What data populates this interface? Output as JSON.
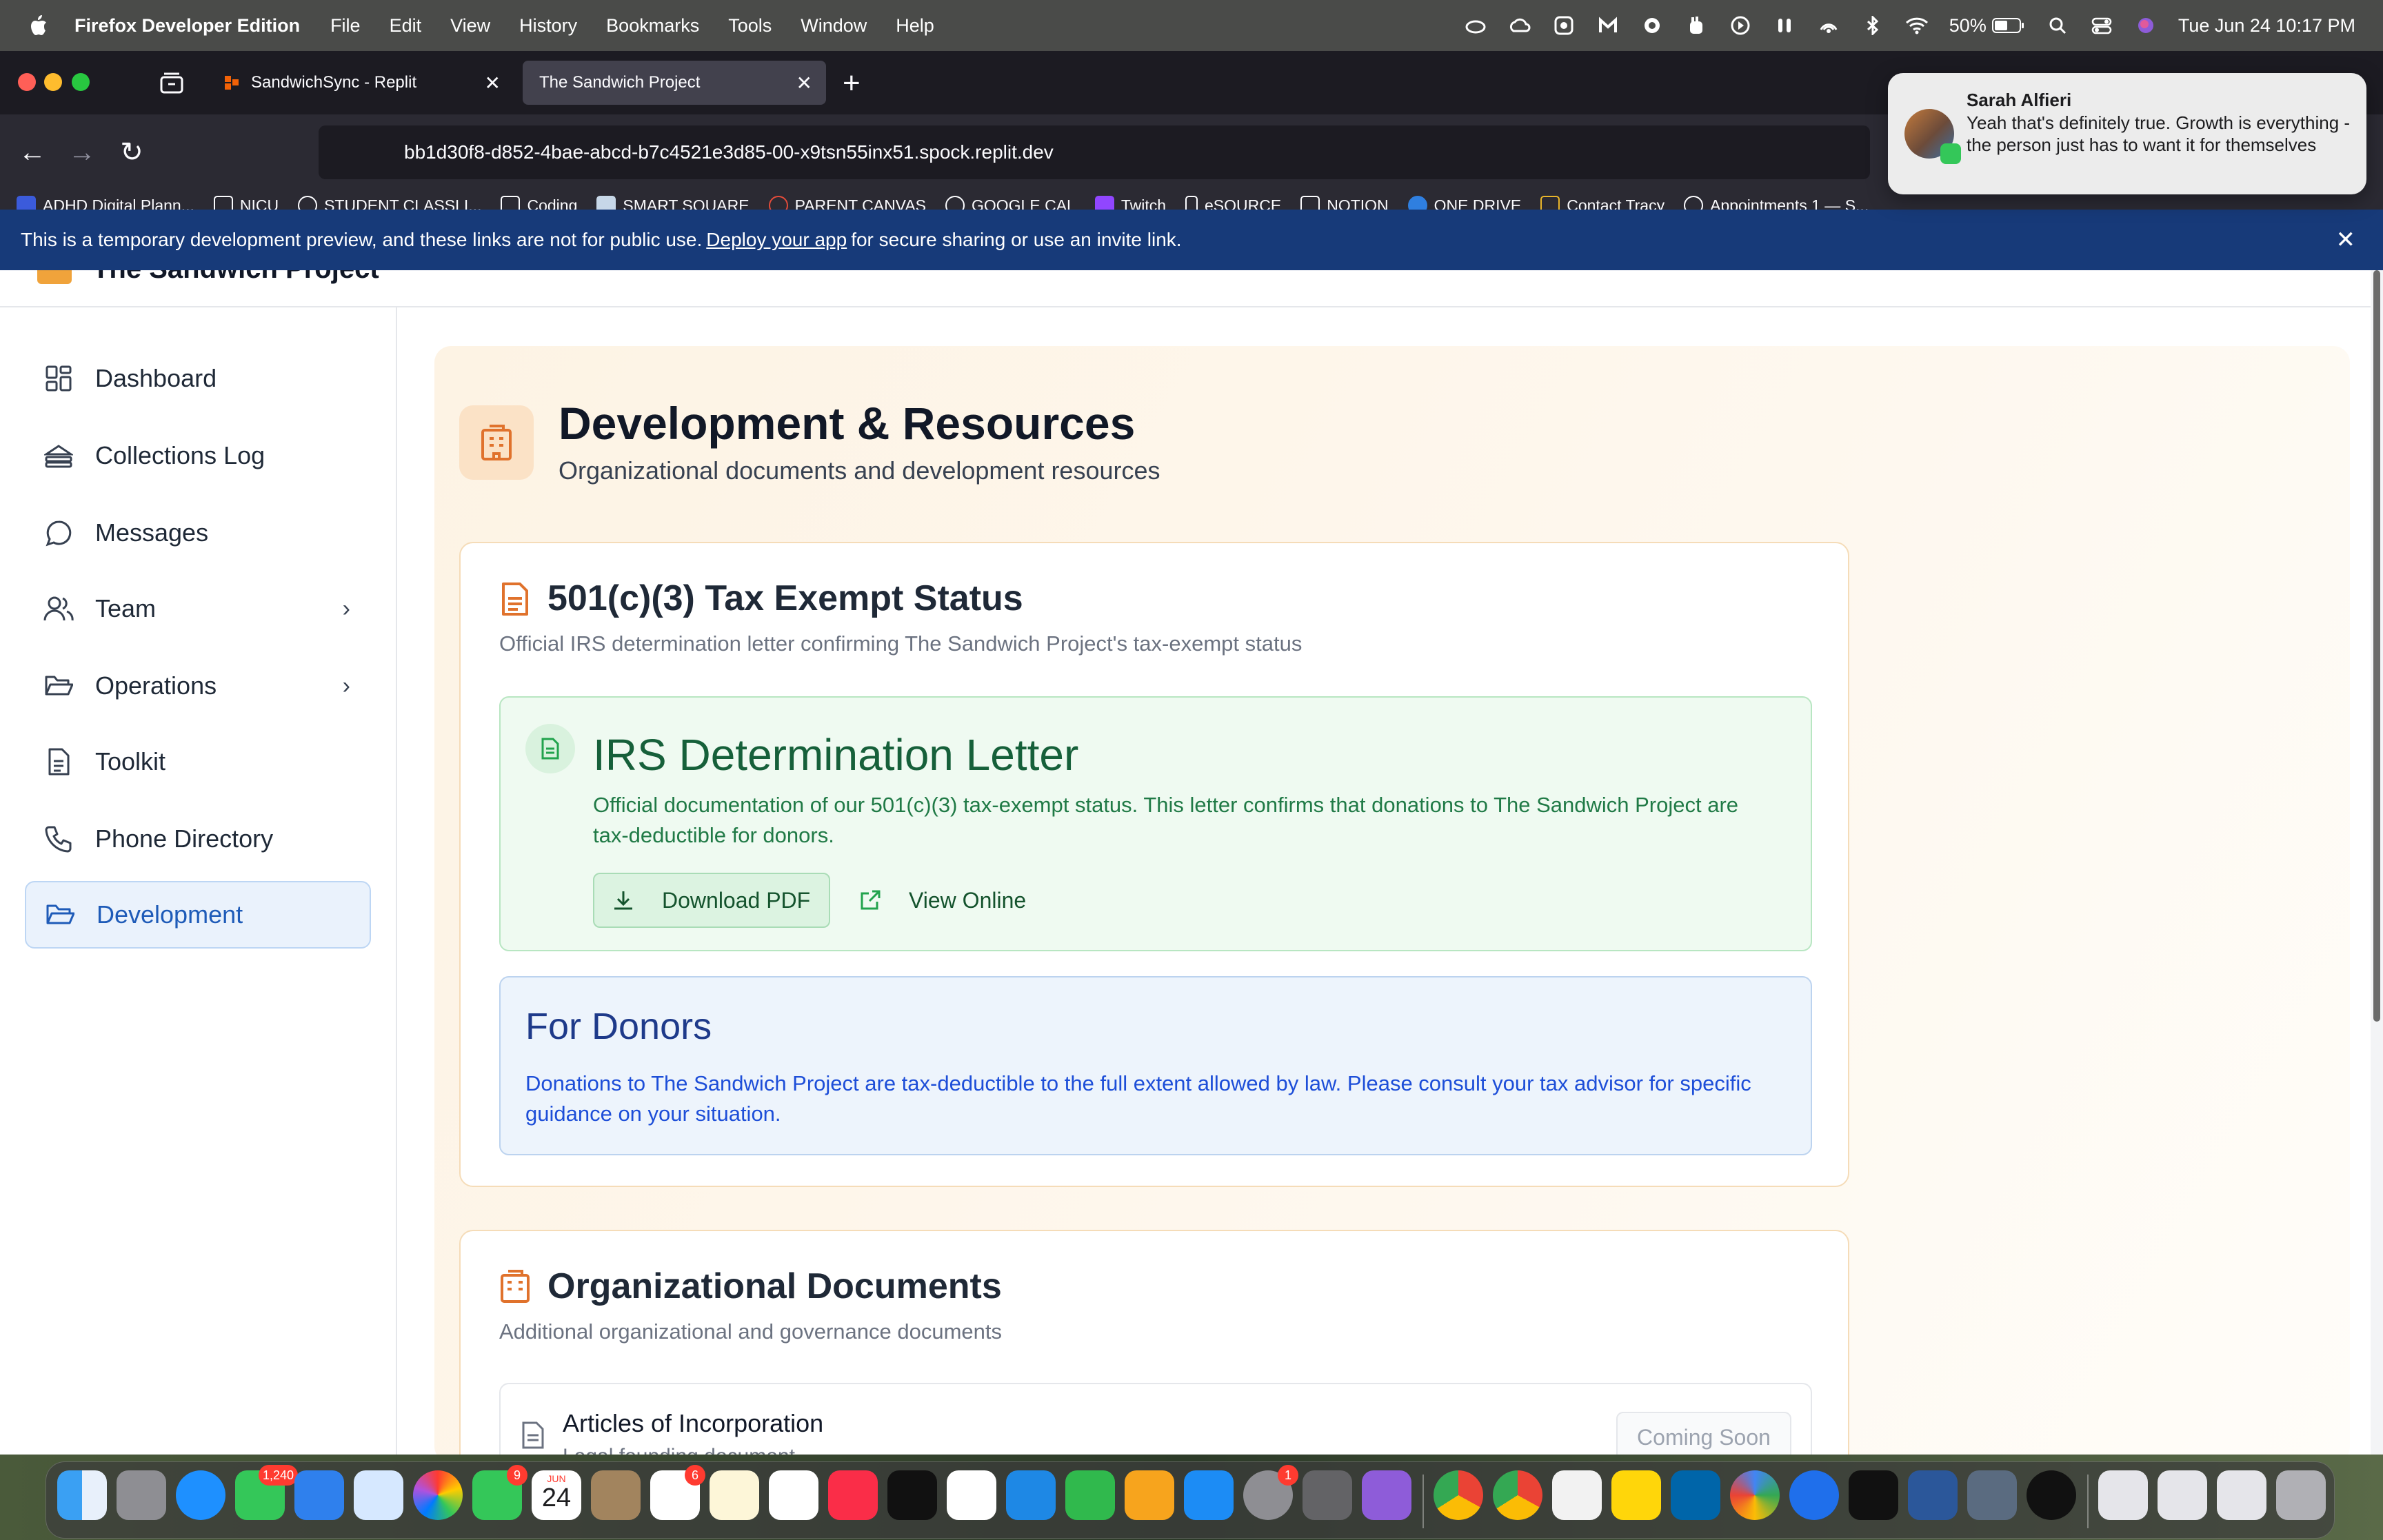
{
  "menubar": {
    "app_name": "Firefox Developer Edition",
    "menus": [
      "File",
      "Edit",
      "View",
      "History",
      "Bookmarks",
      "Tools",
      "Window",
      "Help"
    ],
    "battery": "50%",
    "datetime": "Tue Jun 24  10:17 PM"
  },
  "browser": {
    "tabs": [
      {
        "title": "SandwichSync - Replit",
        "active": false
      },
      {
        "title": "The Sandwich Project",
        "active": true
      }
    ],
    "url": "bb1d30f8-d852-4bae-abcd-b7c4521e3d85-00-x9tsn55inx51.spock.replit.dev",
    "bookmarks": [
      "ADHD Digital Plann...",
      "NICU",
      "STUDENT CLASSLI...",
      "Coding",
      "SMART SQUARE",
      "PARENT CANVAS",
      "GOOGLE CAL",
      "Twitch",
      "eSOURCE",
      "NOTION",
      "ONE DRIVE",
      "Contact Tracy",
      "Appointments 1 — S..."
    ],
    "banner": {
      "prefix": "This is a temporary development preview, and these links are not for public use.",
      "link": "Deploy your app",
      "suffix": "for secure sharing or use an invite link."
    }
  },
  "notification": {
    "sender": "Sarah Alfieri",
    "message": "Yeah that's definitely true. Growth is everything - the person just has to want it for themselves"
  },
  "app": {
    "title": "The Sandwich Project",
    "sidebar": [
      {
        "label": "Dashboard",
        "icon": "dashboard-icon",
        "chevron": false
      },
      {
        "label": "Collections Log",
        "icon": "sandwich-icon",
        "chevron": false
      },
      {
        "label": "Messages",
        "icon": "message-icon",
        "chevron": false
      },
      {
        "label": "Team",
        "icon": "users-icon",
        "chevron": true
      },
      {
        "label": "Operations",
        "icon": "folder-icon",
        "chevron": true
      },
      {
        "label": "Toolkit",
        "icon": "document-icon",
        "chevron": false
      },
      {
        "label": "Phone Directory",
        "icon": "phone-icon",
        "chevron": false
      },
      {
        "label": "Development",
        "icon": "folder-icon",
        "chevron": false,
        "active": true
      }
    ],
    "page": {
      "title": "Development & Resources",
      "subtitle": "Organizational documents and development resources"
    },
    "tax_card": {
      "title": "501(c)(3) Tax Exempt Status",
      "subtitle": "Official IRS determination letter confirming The Sandwich Project's tax-exempt status",
      "irs": {
        "title": "IRS Determination Letter",
        "text": "Official documentation of our 501(c)(3) tax-exempt status. This letter confirms that donations to The Sandwich Project are tax-deductible for donors.",
        "download_label": "Download PDF",
        "view_label": "View Online"
      },
      "donors": {
        "title": "For Donors",
        "text": "Donations to The Sandwich Project are tax-deductible to the full extent allowed by law. Please consult your tax advisor for specific guidance on your situation."
      }
    },
    "org_card": {
      "title": "Organizational Documents",
      "subtitle": "Additional organizational and governance documents",
      "documents": [
        {
          "title": "Articles of Incorporation",
          "subtitle": "Legal founding document",
          "status": "Coming Soon"
        }
      ]
    }
  },
  "colors": {
    "accent_orange": "#e0722c",
    "active_blue": "#1e5bb8",
    "irs_green": "#16603a",
    "donor_blue": "#1e3a8a",
    "banner_blue": "#173a79"
  },
  "dock": {
    "messages_badge": "1,240",
    "facetime_badge": "9",
    "calendar_month": "JUN",
    "calendar_day": "24",
    "reminders_badge": "6",
    "settings_badge": "1"
  }
}
